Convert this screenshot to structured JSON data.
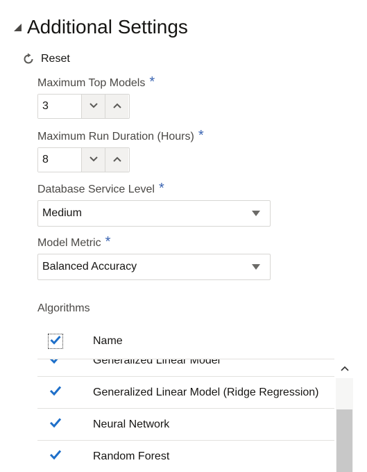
{
  "section": {
    "title": "Additional Settings"
  },
  "reset": {
    "label": "Reset"
  },
  "fields": {
    "max_top_models": {
      "label": "Maximum Top Models",
      "required": "*",
      "value": "3"
    },
    "max_run_duration": {
      "label": "Maximum Run Duration (Hours)",
      "required": "*",
      "value": "8"
    },
    "db_service_level": {
      "label": "Database Service Level",
      "required": "*",
      "value": "Medium"
    },
    "model_metric": {
      "label": "Model Metric",
      "required": "*",
      "value": "Balanced Accuracy"
    }
  },
  "algorithms": {
    "label": "Algorithms",
    "header_name": "Name",
    "header_checked": true,
    "rows": [
      {
        "name": "Generalized Linear Model",
        "checked": true
      },
      {
        "name": "Generalized Linear Model (Ridge Regression)",
        "checked": true
      },
      {
        "name": "Neural Network",
        "checked": true
      },
      {
        "name": "Random Forest",
        "checked": true
      }
    ],
    "scroll_position": 0.55
  },
  "colors": {
    "accent": "#3a64b2",
    "check": "#1e6fc9",
    "text": "#161513",
    "label": "#4a4845",
    "border": "#d7d6d3"
  },
  "icons": {
    "collapse": "triangle-expanded-icon",
    "reset": "refresh-icon",
    "decrement": "chevron-down-icon",
    "increment": "chevron-up-icon",
    "dropdown": "caret-down-icon",
    "scroll_up": "chevron-up-icon"
  }
}
